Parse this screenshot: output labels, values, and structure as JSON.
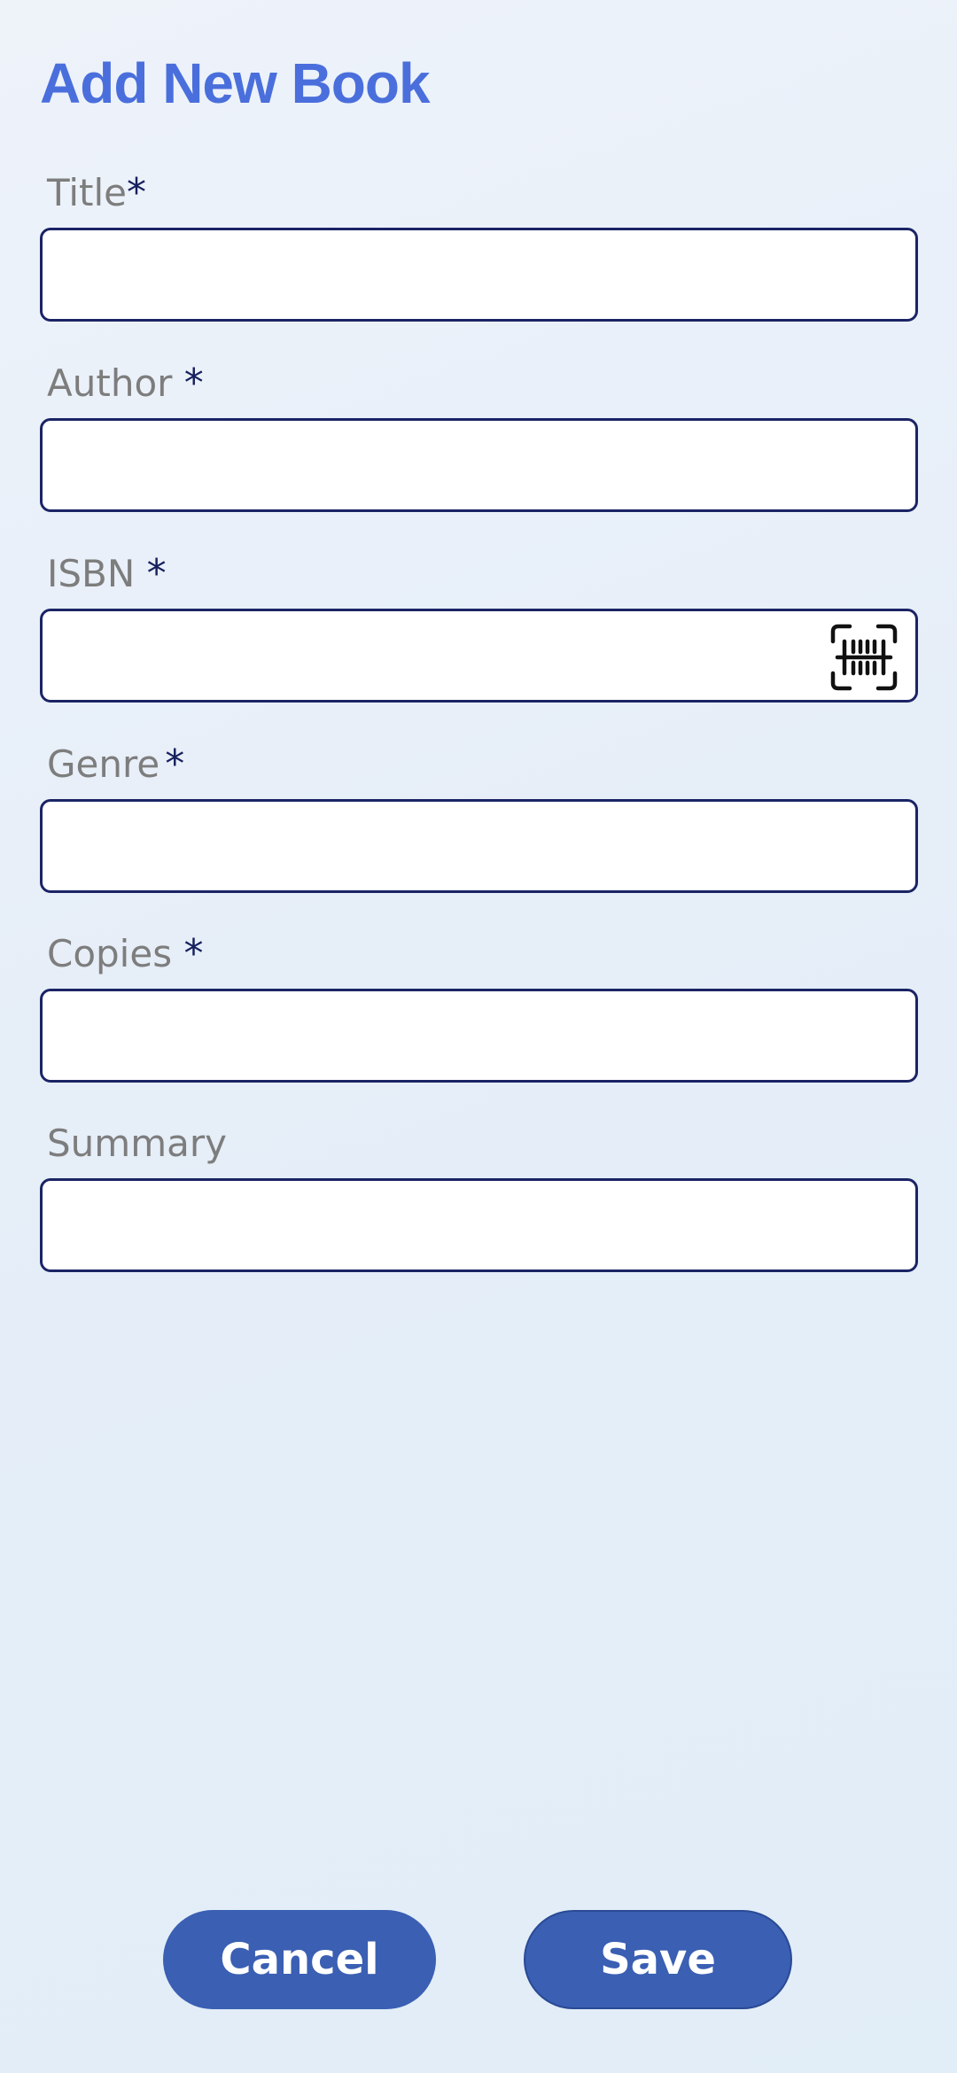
{
  "header": {
    "title": "Add New Book"
  },
  "form": {
    "required_marker": "*",
    "fields": [
      {
        "label": "Title",
        "required": true,
        "value": "",
        "placeholder": ""
      },
      {
        "label": "Author",
        "required": true,
        "value": "",
        "placeholder": ""
      },
      {
        "label": "ISBN",
        "required": true,
        "value": "",
        "placeholder": "",
        "icon": "barcode-scan-icon"
      },
      {
        "label": "Genre",
        "required": true,
        "value": "",
        "placeholder": ""
      },
      {
        "label": "Copies",
        "required": true,
        "value": "",
        "placeholder": ""
      },
      {
        "label": "Summary",
        "required": false,
        "value": "",
        "placeholder": ""
      }
    ]
  },
  "actions": {
    "cancel_label": "Cancel",
    "save_label": "Save"
  },
  "colors": {
    "title": "#4a6fdc",
    "label": "#7d7d7d",
    "required_marker": "#16205e",
    "input_border": "#1b2465",
    "button_bg": "#3a5fb3",
    "button_text": "#ffffff"
  }
}
